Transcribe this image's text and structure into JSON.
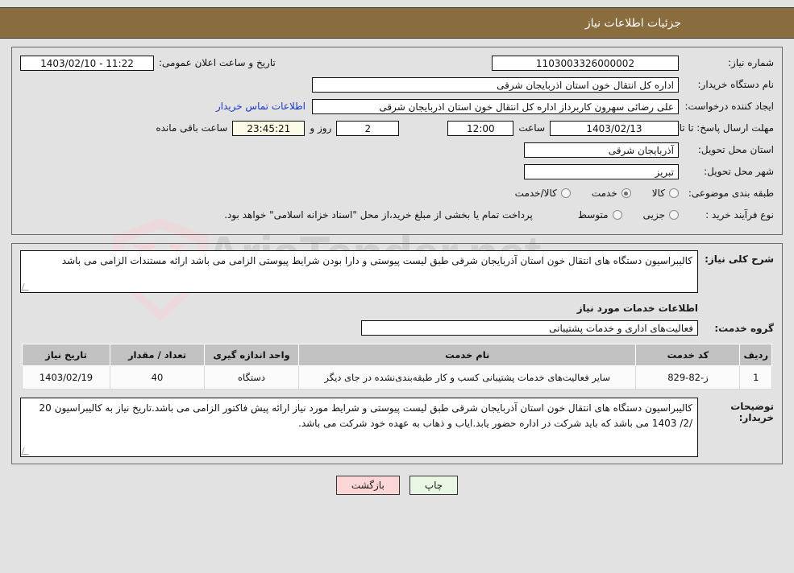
{
  "header": {
    "title": "جزئیات اطلاعات نیاز"
  },
  "colors": {
    "header_bg": "#8a6d3f",
    "link": "#1b36c2",
    "timer_bg": "#fbfbe6",
    "table_header_bg": "#c2c2c2",
    "print_btn_bg": "#e9f6e3",
    "back_btn_bg": "#fbd6d6"
  },
  "watermark": {
    "text": "AriaTender.net"
  },
  "form": {
    "need_number_label": "شماره نیاز:",
    "need_number_value": "1103003326000002",
    "announce_datetime_label": "تاریخ و ساعت اعلان عمومی:",
    "announce_datetime_value": "11:22 - 1403/02/10",
    "buyer_org_label": "نام دستگاه خریدار:",
    "buyer_org_value": "اداره کل انتقال خون استان اذربایجان شرقی",
    "creator_label": "ایجاد کننده درخواست:",
    "creator_value": "علی رضائی سهرون کاربرداز اداره کل انتقال خون استان اذربایجان شرقی",
    "contact_link": "اطلاعات تماس خریدار",
    "deadline_label": "مهلت ارسال پاسخ: تا تاریخ:",
    "deadline_date": "1403/02/13",
    "hour_label": "ساعت",
    "deadline_time": "12:00",
    "days_remaining": "2",
    "days_label": "روز و",
    "countdown": "23:45:21",
    "remaining_label": "ساعت باقی مانده",
    "province_label": "استان محل تحویل:",
    "province_value": "آذربایجان شرقی",
    "city_label": "شهر محل تحویل:",
    "city_value": "تبریز",
    "category_label": "طبقه بندی موضوعی:",
    "category_options": [
      {
        "label": "کالا",
        "checked": false
      },
      {
        "label": "خدمت",
        "checked": true
      },
      {
        "label": "کالا/خدمت",
        "checked": false
      }
    ],
    "process_label": "نوع فرآیند خرید :",
    "process_options": [
      {
        "label": "جزیی",
        "checked": false
      },
      {
        "label": "متوسط",
        "checked": false
      }
    ],
    "payment_note": "پرداخت تمام یا بخشی از مبلغ خرید،از محل \"اسناد خزانه اسلامی\" خواهد بود."
  },
  "description": {
    "label": "شرح کلی نیاز:",
    "text": "کالیبراسیون دستگاه های انتقال خون استان آذربایجان شرقی طبق لیست پیوستی و دارا بودن شرایط پیوستی الزامی می باشد ارائه مستندات الزامی می باشد"
  },
  "services_section": {
    "title": "اطلاعات خدمات مورد نیاز",
    "group_label": "گروه خدمت:",
    "group_value": "فعالیت‌های اداری و خدمات پشتیبانی"
  },
  "items_table": {
    "columns": [
      "ردیف",
      "کد خدمت",
      "نام خدمت",
      "واحد اندازه گیری",
      "تعداد / مقدار",
      "تاریخ نیاز"
    ],
    "rows": [
      {
        "radif": "1",
        "code": "ز-82-829",
        "name": "سایر فعالیت‌های خدمات پشتیبانی کسب و کار طبقه‌بندی‌نشده در جای دیگر",
        "unit": "دستگاه",
        "qty": "40",
        "date": "1403/02/19"
      }
    ]
  },
  "buyer_notes": {
    "label": "توضیحات خریدار:",
    "text": "کالیبراسیون دستگاه های انتقال خون استان آذربایجان شرقی طبق لیست پیوستی و شرایط مورد نیاز ارائه پیش فاکتور الزامی می باشد.تاریخ نیاز به کالیبراسیون 20 /2/ 1403 می باشد که باید شرکت در اداره حضور یابد.ایاب و ذهاب به عهده خود شرکت می باشد."
  },
  "buttons": {
    "print": "چاپ",
    "back": "بازگشت"
  }
}
